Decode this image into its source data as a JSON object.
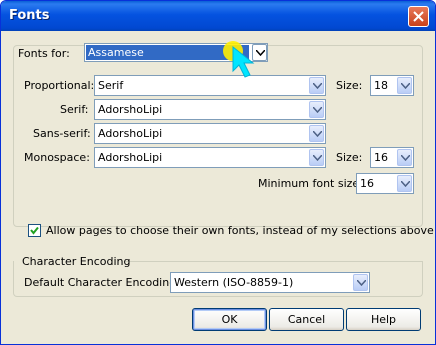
{
  "window": {
    "title": "Fonts"
  },
  "fonts_for": {
    "label": "Fonts for:",
    "value": "Assamese"
  },
  "proportional": {
    "label": "Proportional:",
    "value": "Serif",
    "size_label": "Size:",
    "size_value": "18"
  },
  "serif": {
    "label": "Serif:",
    "value": "AdorshoLipi"
  },
  "sans_serif": {
    "label": "Sans-serif:",
    "value": "AdorshoLipi"
  },
  "monospace": {
    "label": "Monospace:",
    "value": "AdorshoLipi",
    "size_label": "Size:",
    "size_value": "16"
  },
  "min_font": {
    "label": "Minimum font size:",
    "value": "16"
  },
  "allow_pages": {
    "label": "Allow pages to choose their own fonts, instead of my selections above",
    "checked": true
  },
  "encoding": {
    "group_title": "Character Encoding",
    "label": "Default Character Encoding:",
    "value": "Western (ISO-8859-1)"
  },
  "buttons": {
    "ok": "OK",
    "cancel": "Cancel",
    "help": "Help"
  },
  "colors": {
    "titlebar": "#0553e0",
    "selection": "#316ac5",
    "dialog_bg": "#ece9d8",
    "cursor_highlight": "#ffee00",
    "cursor_arrow": "#00e5ff"
  }
}
